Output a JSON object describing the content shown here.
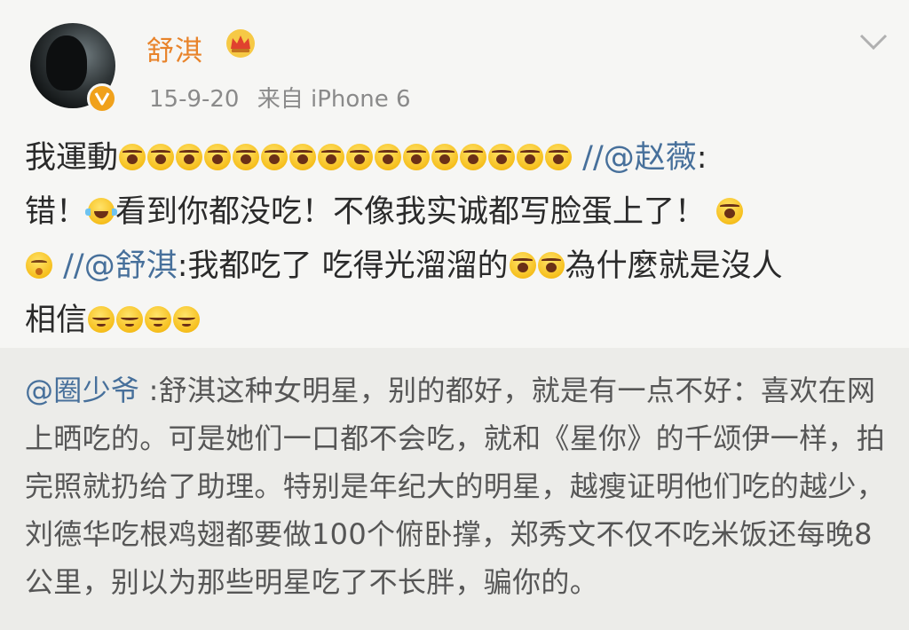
{
  "post": {
    "username": "舒淇",
    "date": "15-9-20",
    "source": "来自 iPhone 6",
    "crown_icon": "crown-icon",
    "verified_icon": "verified-v-icon",
    "menu_icon": "chevron-down-icon",
    "colors": {
      "username": "#e8832a",
      "link": "#47709b",
      "badge": "#f0a11b"
    },
    "line1_text": "我運動",
    "line1_mention": "//@赵薇",
    "line1_colon": ":",
    "line2_a": "错！",
    "line2_b": "看到你都没吃！不像我实诚都写脸蛋上了！",
    "line3_mention": "//@舒淇",
    "line3_a": ":我都吃了 吃得光溜溜的",
    "line3_b": "為什麼就是沒人",
    "line4_a": "相信"
  },
  "quote": {
    "mention": "@圈少爷",
    "text": " :舒淇这种女明星，别的都好，就是有一点不好：喜欢在网上晒吃的。可是她们一口都不会吃，就和《星你》的千颂伊一样，拍完照就扔给了助理。特别是年纪大的明星，越瘦证明他们吃的越少，刘德华吃根鸡翅都要做100个俯卧撑，郑秀文不仅不吃米饭还每晚8公里，别以为那些明星吃了不长胖，骗你的。"
  }
}
